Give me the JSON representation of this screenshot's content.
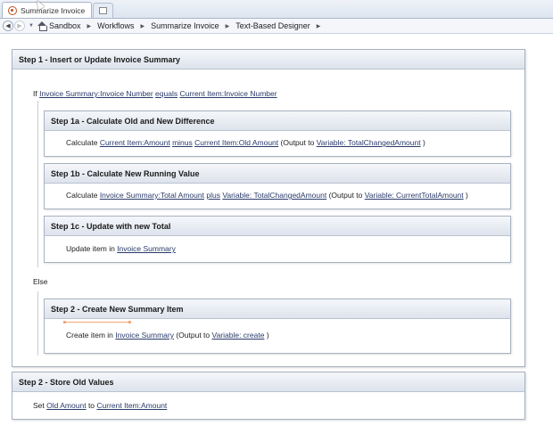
{
  "tab": {
    "title": "Summarize Invoice"
  },
  "breadcrumb": [
    "Sandbox",
    "Workflows",
    "Summarize Invoice",
    "Text-Based Designer"
  ],
  "workflow": {
    "step1": {
      "title": "Step 1 - Insert or Update Invoice Summary",
      "condition": {
        "if_word": "If",
        "left": "Invoice Summary:Invoice Number",
        "operator": "equals",
        "right": "Current Item:Invoice Number"
      },
      "step1a": {
        "title": "Step 1a - Calculate Old and New Difference",
        "calc_word": "Calculate",
        "operand1": "Current Item:Amount",
        "operator": "minus",
        "operand2": "Current Item:Old Amount",
        "output_prefix": "(Output to",
        "output_var": "Variable: TotalChangedAmount",
        "output_suffix": ")"
      },
      "step1b": {
        "title": "Step 1b - Calculate New Running Value",
        "calc_word": "Calculate",
        "operand1": "Invoice Summary:Total Amount",
        "operator": "plus",
        "operand2": "Variable: TotalChangedAmount",
        "output_prefix": "(Output to",
        "output_var": "Variable: CurrentTotalAmount",
        "output_suffix": ")"
      },
      "step1c": {
        "title": "Step 1c - Update with new Total",
        "action": "Update item in",
        "list": "Invoice Summary"
      },
      "else_word": "Else",
      "step2inner": {
        "title": "Step 2 - Create New Summary Item",
        "action": "Create item in",
        "list": "Invoice Summary",
        "output_prefix": "(Output to",
        "output_var": "Variable: create",
        "output_suffix": ")"
      }
    },
    "step2": {
      "title": "Step 2 - Store Old Values",
      "set_word": "Set",
      "field": "Old Amount",
      "to_word": "to",
      "value": "Current Item:Amount"
    }
  },
  "icons": {
    "tab_icon": "workflow-icon",
    "new_tab_icon": "new-tab-icon",
    "back": "back-icon",
    "forward": "forward-icon",
    "home": "home-icon"
  }
}
